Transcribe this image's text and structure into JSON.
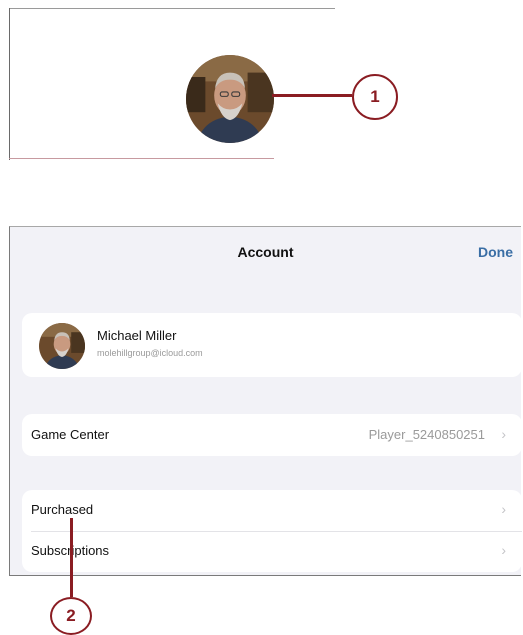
{
  "callouts": {
    "one": "1",
    "two": "2"
  },
  "account": {
    "title": "Account",
    "done_label": "Done",
    "profile": {
      "name": "Michael Miller",
      "email": "molehillgroup@icloud.com"
    },
    "game_center": {
      "label": "Game Center",
      "value": "Player_5240850251"
    },
    "rows": [
      {
        "label": "Purchased"
      },
      {
        "label": "Subscriptions"
      }
    ],
    "chevron": "›"
  },
  "icons": [
    "profile-photo",
    "chevron-right-icon"
  ],
  "colors": {
    "callout": "#8a1c22",
    "accent": "#3a6ea5",
    "background": "#f2f2f7"
  }
}
